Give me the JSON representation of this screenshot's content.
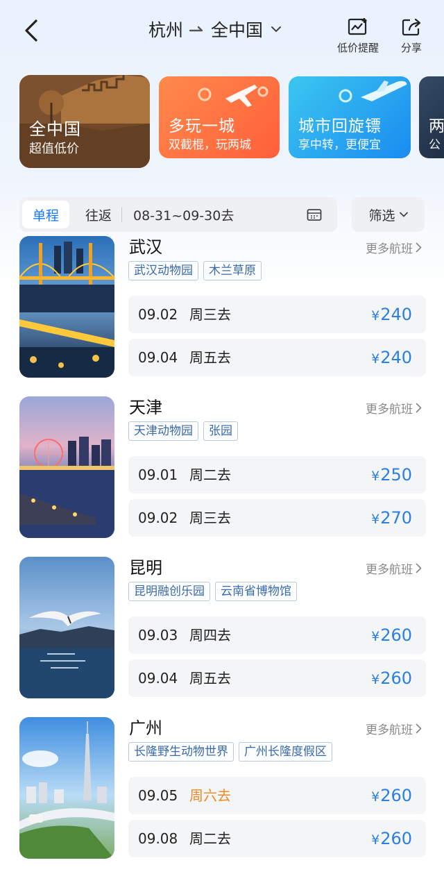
{
  "header": {
    "origin": "杭州",
    "destination": "全中国",
    "price_alert_label": "低价提醒",
    "share_label": "分享"
  },
  "promos": [
    {
      "title": "全中国",
      "subtitle": "超值低价"
    },
    {
      "title": "多玩一城",
      "subtitle": "双截棍，玩两城"
    },
    {
      "title": "城市回旋镖",
      "subtitle": "享中转，更便宜"
    },
    {
      "title": "两",
      "subtitle": "公"
    }
  ],
  "filter": {
    "one_way": "单程",
    "round_trip": "往返",
    "date_range": "08-31~09-30去",
    "filter_label": "筛选"
  },
  "more_label": "更多航班",
  "cities": [
    {
      "name": "武汉",
      "tags": [
        "武汉动物园",
        "木兰草原"
      ],
      "flights": [
        {
          "date": "09.02",
          "weekday": "周三去",
          "price": "240",
          "weekend": false
        },
        {
          "date": "09.04",
          "weekday": "周五去",
          "price": "240",
          "weekend": false
        }
      ]
    },
    {
      "name": "天津",
      "tags": [
        "天津动物园",
        "张园"
      ],
      "flights": [
        {
          "date": "09.01",
          "weekday": "周二去",
          "price": "250",
          "weekend": false
        },
        {
          "date": "09.02",
          "weekday": "周三去",
          "price": "270",
          "weekend": false
        }
      ]
    },
    {
      "name": "昆明",
      "tags": [
        "昆明融创乐园",
        "云南省博物馆"
      ],
      "flights": [
        {
          "date": "09.03",
          "weekday": "周四去",
          "price": "260",
          "weekend": false
        },
        {
          "date": "09.04",
          "weekday": "周五去",
          "price": "260",
          "weekend": false
        }
      ]
    },
    {
      "name": "广州",
      "tags": [
        "长隆野生动物世界",
        "广州长隆度假区"
      ],
      "flights": [
        {
          "date": "09.05",
          "weekday": "周六去",
          "price": "260",
          "weekend": true
        },
        {
          "date": "09.08",
          "weekday": "周二去",
          "price": "260",
          "weekend": false
        }
      ]
    }
  ],
  "currency_symbol": "¥",
  "colors": {
    "accent": "#1677ff",
    "price": "#2b7fe0",
    "weekend": "#f08a24"
  }
}
